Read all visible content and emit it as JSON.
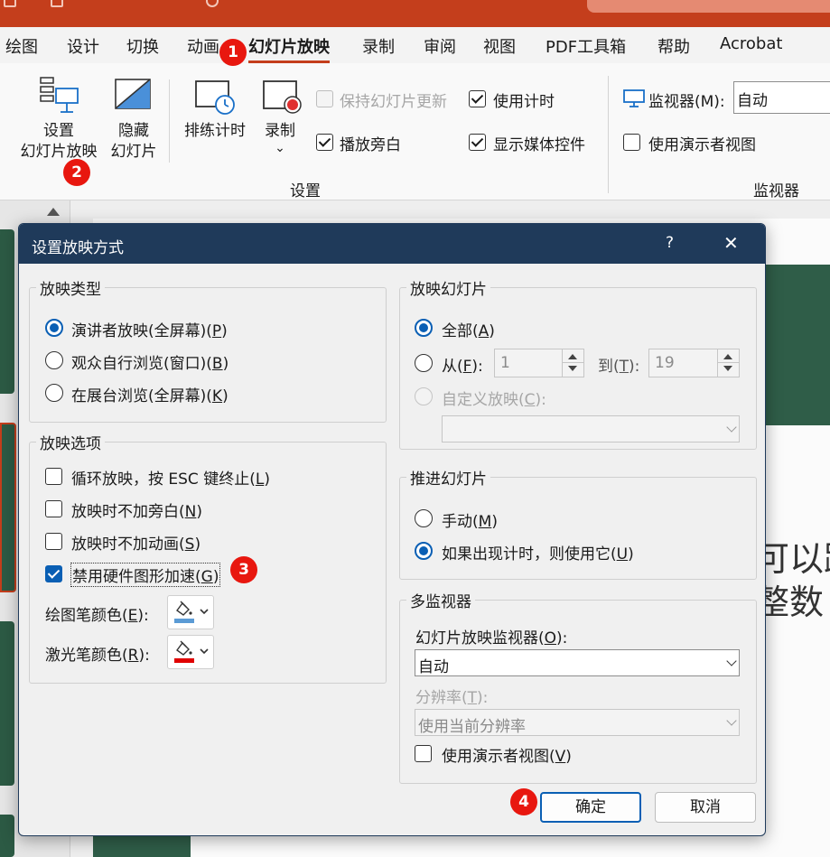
{
  "colors": {
    "accent": "#c43e1c",
    "dialog_header": "#1f3a5a",
    "checked_blue": "#0a5fb4",
    "badge_red": "#e8170f",
    "pen_blue": "#5b9bd5",
    "laser_red": "#e00000"
  },
  "menu_tabs": [
    "绘图",
    "设计",
    "切换",
    "动画",
    "幻灯片放映",
    "录制",
    "审阅",
    "视图",
    "PDF工具箱",
    "帮助",
    "Acrobat"
  ],
  "ribbon": {
    "setup_show_line1": "设置",
    "setup_show_line2": "幻灯片放映",
    "hide_slide_line1": "隐藏",
    "hide_slide_line2": "幻灯片",
    "rehearse": "排练计时",
    "record": "录制",
    "record_chevron": "⌄",
    "keep_updated": "保持幻灯片更新",
    "use_timings": "使用计时",
    "play_narrations": "播放旁白",
    "show_media_controls": "显示媒体控件",
    "monitor_label": "监视器(M):",
    "monitor_value": "自动",
    "use_presenter_view": "使用演示者视图",
    "group_setup": "设置",
    "group_monitors": "监视器"
  },
  "slide_text": {
    "line1": "可以跟",
    "line2": "整数"
  },
  "dialog": {
    "title": "设置放映方式",
    "help": "?",
    "close": "✕",
    "show_type": {
      "legend": "放映类型",
      "presenter": "演讲者放映(全屏幕)(",
      "presenter_key": "P",
      "browsed": "观众自行浏览(窗口)(",
      "browsed_key": "B",
      "kiosk": "在展台浏览(全屏幕)(",
      "kiosk_key": "K",
      "close_paren": ")"
    },
    "show_options": {
      "legend": "放映选项",
      "loop": "循环放映，按 ESC 键终止(",
      "loop_key": "L",
      "no_narration": "放映时不加旁白(",
      "no_narration_key": "N",
      "no_animation": "放映时不加动画(",
      "no_animation_key": "S",
      "disable_hw": "禁用硬件图形加速(",
      "disable_hw_key": "G",
      "pen_color": "绘图笔颜色(",
      "pen_color_key": "E",
      "laser_color": "激光笔颜色(",
      "laser_color_key": "R",
      "close_paren_colon": "):"
    },
    "show_slides": {
      "legend": "放映幻灯片",
      "all": "全部(",
      "all_key": "A",
      "from": "从(",
      "from_key": "F",
      "from_value": "1",
      "to": "到(",
      "to_key": "T",
      "to_value": "19",
      "custom": "自定义放映(",
      "custom_key": "C",
      "colon_suffix": "):",
      "close_paren": ")"
    },
    "advance": {
      "legend": "推进幻灯片",
      "manual": "手动(",
      "manual_key": "M",
      "timings": "如果出现计时，则使用它(",
      "timings_key": "U",
      "close_paren": ")"
    },
    "multi_monitor": {
      "legend": "多监视器",
      "slideshow_monitor": "幻灯片放映监视器(",
      "slideshow_monitor_key": "O",
      "monitor_value": "自动",
      "resolution": "分辨率(",
      "resolution_key": "T",
      "resolution_value": "使用当前分辨率",
      "presenter_view": "使用演示者视图(",
      "presenter_view_key": "V",
      "colon_suffix": "):",
      "close_paren": ")"
    },
    "ok": "确定",
    "cancel": "取消"
  },
  "badges": [
    "1",
    "2",
    "3",
    "4"
  ]
}
